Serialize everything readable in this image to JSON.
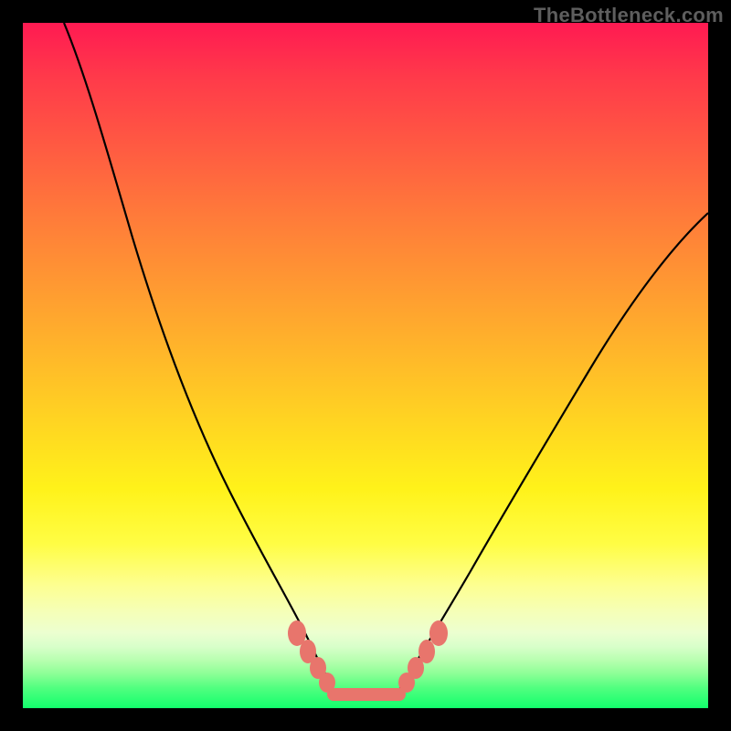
{
  "watermark": "TheBottleneck.com",
  "colors": {
    "black": "#000000",
    "marker": "#e8756c",
    "gradient_top": "#ff1a52",
    "gradient_bottom": "#12ff6c"
  },
  "chart_data": {
    "type": "line",
    "title": "",
    "xlabel": "",
    "ylabel": "",
    "xlim": [
      0,
      100
    ],
    "ylim": [
      0,
      100
    ],
    "left_curve": {
      "x": [
        6,
        10,
        15,
        20,
        25,
        30,
        35,
        38,
        40,
        42,
        44,
        45
      ],
      "y": [
        100,
        88,
        72,
        56,
        42,
        30,
        20,
        14,
        11,
        8,
        5,
        3
      ]
    },
    "right_curve": {
      "x": [
        55,
        58,
        62,
        67,
        72,
        78,
        84,
        90,
        96,
        100
      ],
      "y": [
        3,
        6,
        11,
        18,
        26,
        36,
        47,
        57,
        66,
        72
      ]
    },
    "flat_segment": {
      "x_start": 45,
      "x_end": 55,
      "y": 2
    },
    "markers_left": [
      {
        "x": 40,
        "y": 11
      },
      {
        "x": 41.5,
        "y": 8.5
      },
      {
        "x": 43,
        "y": 6
      },
      {
        "x": 44.3,
        "y": 4
      }
    ],
    "markers_right": [
      {
        "x": 56,
        "y": 4
      },
      {
        "x": 57.3,
        "y": 6
      },
      {
        "x": 59,
        "y": 8.5
      },
      {
        "x": 60.5,
        "y": 11
      }
    ]
  }
}
